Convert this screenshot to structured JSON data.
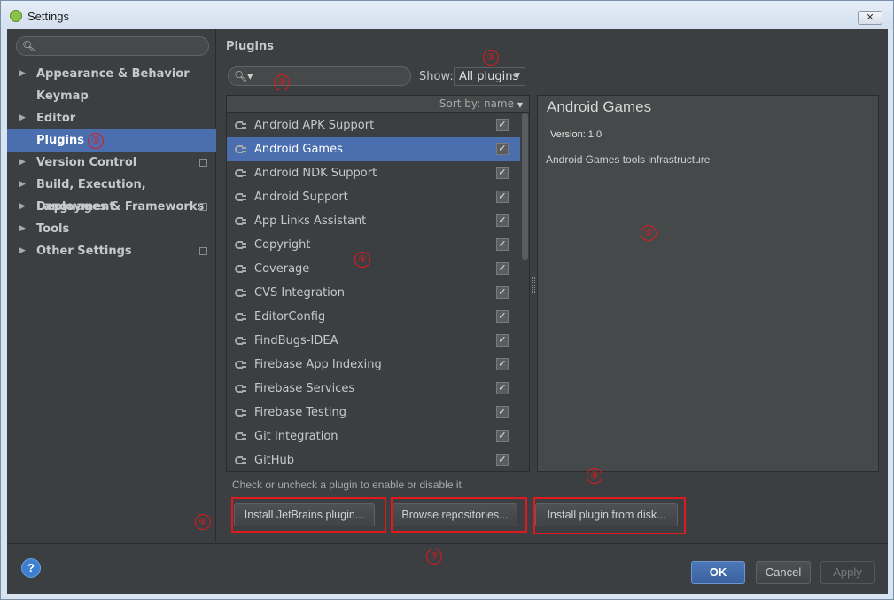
{
  "window": {
    "title": "Settings",
    "close_glyph": "✕"
  },
  "sidebar": {
    "search_placeholder": "",
    "items": [
      {
        "label": "Appearance & Behavior",
        "expandable": true,
        "project": false
      },
      {
        "label": "Keymap",
        "expandable": false,
        "project": false
      },
      {
        "label": "Editor",
        "expandable": true,
        "project": false
      },
      {
        "label": "Plugins",
        "expandable": false,
        "project": false,
        "selected": true
      },
      {
        "label": "Version Control",
        "expandable": true,
        "project": true
      },
      {
        "label": "Build, Execution, Deployment",
        "expandable": true,
        "project": false
      },
      {
        "label": "Languages & Frameworks",
        "expandable": true,
        "project": true
      },
      {
        "label": "Tools",
        "expandable": true,
        "project": false
      },
      {
        "label": "Other Settings",
        "expandable": true,
        "project": true
      }
    ]
  },
  "main": {
    "heading": "Plugins",
    "search_placeholder": "",
    "show_label": "Show:",
    "show_value": "All plugins",
    "sort_label": "Sort by: name",
    "plugins": [
      {
        "name": "Android APK Support",
        "checked": true
      },
      {
        "name": "Android Games",
        "checked": true,
        "selected": true
      },
      {
        "name": "Android NDK Support",
        "checked": true
      },
      {
        "name": "Android Support",
        "checked": true
      },
      {
        "name": "App Links Assistant",
        "checked": true
      },
      {
        "name": "Copyright",
        "checked": true
      },
      {
        "name": "Coverage",
        "checked": true
      },
      {
        "name": "CVS Integration",
        "checked": true
      },
      {
        "name": "EditorConfig",
        "checked": true
      },
      {
        "name": "FindBugs-IDEA",
        "checked": true
      },
      {
        "name": "Firebase App Indexing",
        "checked": true
      },
      {
        "name": "Firebase Services",
        "checked": true
      },
      {
        "name": "Firebase Testing",
        "checked": true
      },
      {
        "name": "Git Integration",
        "checked": true
      },
      {
        "name": "GitHub",
        "checked": true
      }
    ],
    "detail": {
      "name": "Android Games",
      "version": "Version: 1.0",
      "description": "Android Games tools infrastructure"
    },
    "hint": "Check or uncheck a plugin to enable or disable it.",
    "buttons": {
      "install_jetbrains": "Install JetBrains plugin...",
      "browse_repos": "Browse repositories...",
      "install_disk": "Install plugin from disk..."
    }
  },
  "annotations": {
    "m1": "①",
    "m2": "②",
    "m3": "③",
    "m4": "④",
    "m5": "⑤",
    "m6": "⑥",
    "m7": "⑦",
    "m8": "⑧"
  },
  "footer": {
    "help": "?",
    "ok": "OK",
    "cancel": "Cancel",
    "apply": "Apply"
  },
  "colors": {
    "accent": "#4b6eaf",
    "background": "#3c3f41",
    "annotation": "#e0191e"
  }
}
